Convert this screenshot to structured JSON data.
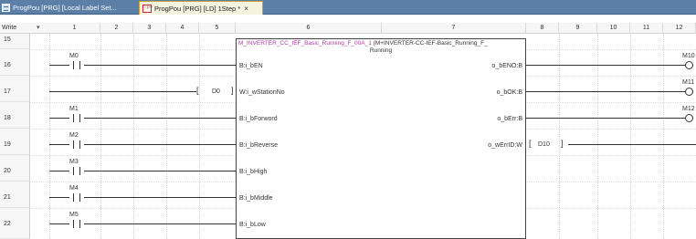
{
  "tabs": [
    {
      "label": "ProgPou [PRG] [Local Label Set...",
      "icon": "program-icon"
    },
    {
      "label": "ProgPou [PRG] [LD] 1Step *",
      "icon": "ladder-icon",
      "close": "×"
    }
  ],
  "header": {
    "mode_label": "Write",
    "mode_arrow": "▾",
    "columns": [
      "1",
      "2",
      "3",
      "4",
      "5",
      "6",
      "7",
      "8",
      "9",
      "10",
      "11",
      "12"
    ]
  },
  "rows": [
    "15",
    "16",
    "17",
    "18",
    "19",
    "20",
    "21",
    "22"
  ],
  "ladder": {
    "contacts": [
      "M0",
      "M1",
      "M2",
      "M3",
      "M4",
      "M5"
    ],
    "input_operand": "D0",
    "output_operand": "D10",
    "coils": [
      "M10",
      "M11",
      "M12"
    ]
  },
  "function_block": {
    "instance_name": "M_INVERTER_CC_IEF_Basic_Running_F_00A_1",
    "type_name_line1": "(M+INVERTER-CC-IEF-Basic_Running_F_",
    "type_name_line2": "Running",
    "inputs": [
      "B:i_bEN",
      "W:i_wStationNo",
      "B:i_bForword",
      "B:i_bReverse",
      "B:i_bHigh",
      "B:i_bMiddle",
      "B:i_bLow"
    ],
    "outputs": [
      "o_bENO:B",
      "o_bOK:B",
      "o_bErr:B",
      "o_wErrID:W"
    ]
  }
}
